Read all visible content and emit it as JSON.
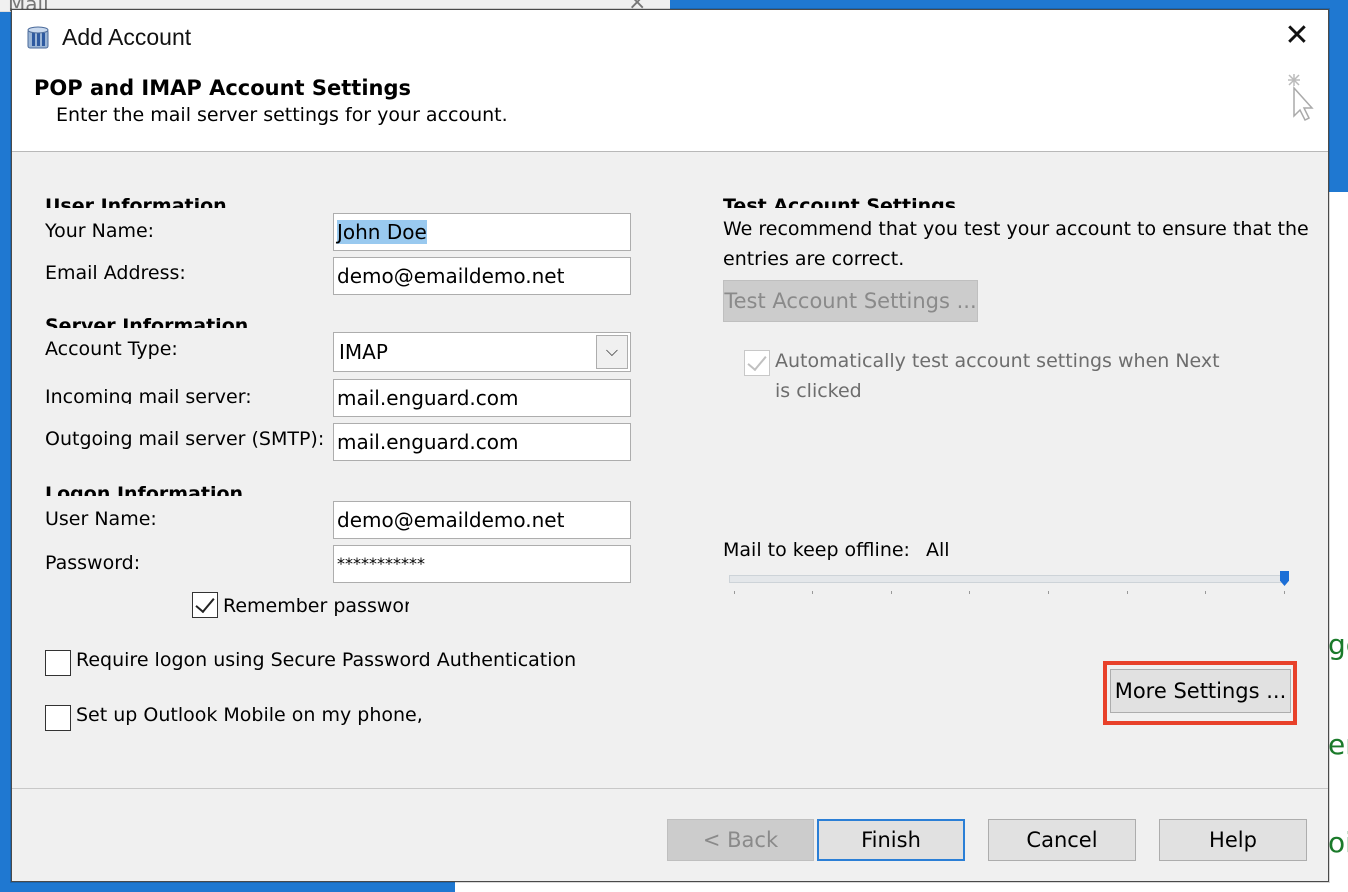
{
  "background": {
    "mail_window_title": "Mail",
    "right_fragments": [
      "ge",
      "er",
      "oit"
    ]
  },
  "dialog": {
    "title": "Add Account",
    "header": {
      "title": "POP and IMAP Account Settings",
      "subtitle": "Enter the mail server settings for your account."
    },
    "user_info": {
      "section": "User Information",
      "name_label": "Your Name:",
      "name_value": "John Doe",
      "email_label": "Email Address:",
      "email_value": "demo@emaildemo.net"
    },
    "server_info": {
      "section": "Server Information",
      "account_type_label": "Account Type:",
      "account_type_value": "IMAP",
      "incoming_label": "Incoming mail server:",
      "incoming_value": "mail.enguard.com",
      "outgoing_label": "Outgoing mail server (SMTP):",
      "outgoing_value": "mail.enguard.com"
    },
    "logon_info": {
      "section": "Logon Information",
      "username_label": "User Name:",
      "username_value": "demo@emaildemo.net",
      "password_label": "Password:",
      "password_value": "***********",
      "remember_label": "Remember password",
      "remember_checked": true
    },
    "options": {
      "spa_label": "Require logon using Secure Password Authentication",
      "spa_checked": false,
      "mobile_label": "Set up Outlook Mobile on my phone,",
      "mobile_checked": false
    },
    "test": {
      "section": "Test Account Settings",
      "description_line1": "We recommend that you test your account to ensure that the",
      "description_line2": "entries are correct.",
      "button_label": "Test Account Settings ...",
      "auto_label_line1": "Automatically test account settings when Next",
      "auto_label_line2": "is clicked",
      "auto_checked": true
    },
    "offline": {
      "label": "Mail to keep offline:",
      "value": "All",
      "slider_level": 1.0
    },
    "more_settings_label": "More Settings ...",
    "footer": {
      "back_label": "< Back",
      "finish_label": "Finish",
      "cancel_label": "Cancel",
      "help_label": "Help"
    }
  },
  "colors": {
    "highlight": "#e8412a",
    "accent": "#2b7fd6",
    "selection": "#99c9ef"
  }
}
